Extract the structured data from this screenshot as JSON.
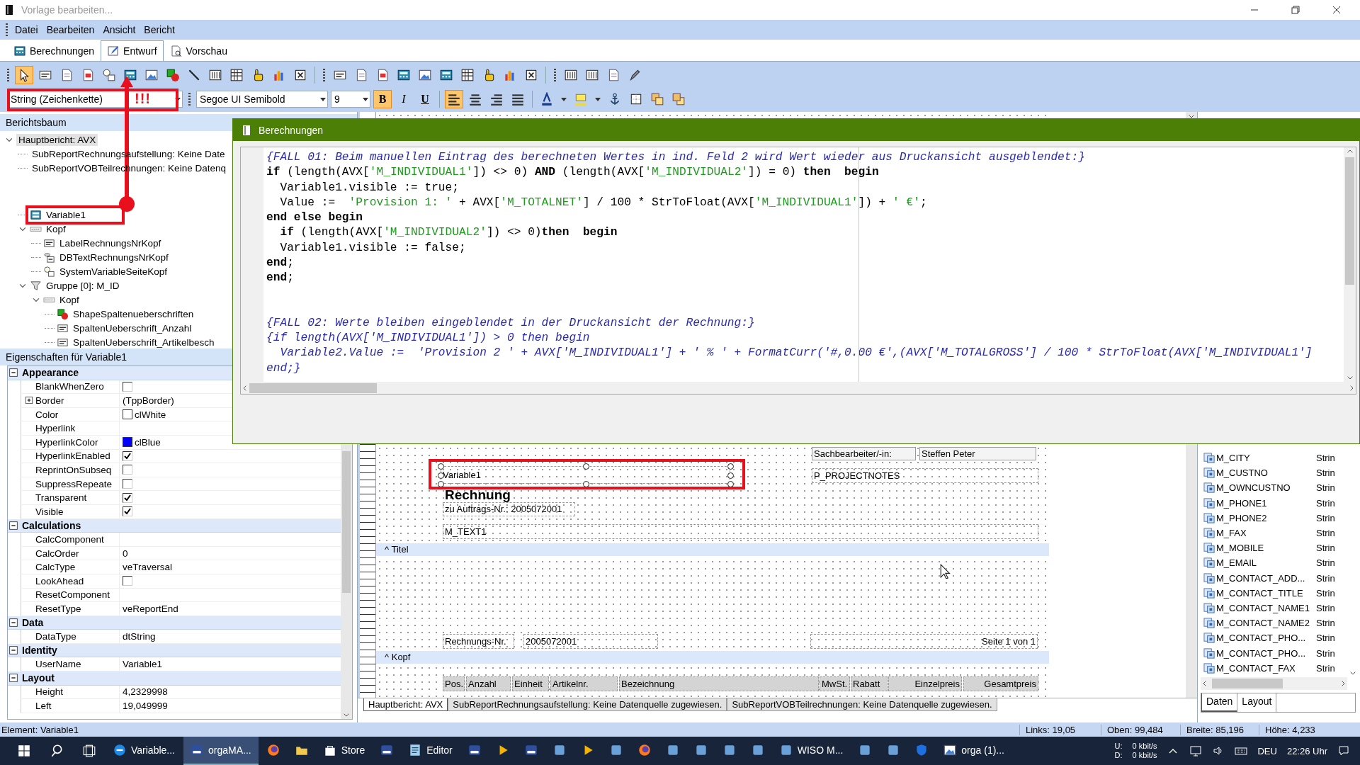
{
  "window": {
    "title": "Vorlage bearbeiten..."
  },
  "menu": [
    {
      "label": "Datei"
    },
    {
      "label": "Bearbeiten"
    },
    {
      "label": "Ansicht"
    },
    {
      "label": "Bericht"
    }
  ],
  "tabs": [
    {
      "label": "Berechnungen",
      "kind": "calc",
      "selected": false
    },
    {
      "label": "Entwurf",
      "kind": "edit",
      "selected": true
    },
    {
      "label": "Vorschau",
      "kind": "preview",
      "selected": false
    }
  ],
  "tools": [
    {
      "kind": "pointer",
      "selected": true
    },
    {
      "kind": "label",
      "selected": false
    },
    {
      "kind": "page",
      "selected": false
    },
    {
      "kind": "pagered",
      "selected": false
    },
    {
      "kind": "sysvar",
      "selected": false
    },
    {
      "kind": "calc",
      "selected": false
    },
    {
      "kind": "image",
      "selected": false
    },
    {
      "kind": "shape",
      "selected": false
    },
    {
      "kind": "line",
      "selected": false
    },
    {
      "kind": "table",
      "selected": false
    },
    {
      "kind": "grid",
      "selected": false
    },
    {
      "kind": "hand",
      "selected": false
    },
    {
      "kind": "chart",
      "selected": false
    },
    {
      "kind": "xbox",
      "selected": false
    },
    {
      "kind": "label",
      "selected": false
    },
    {
      "kind": "page",
      "selected": false
    },
    {
      "kind": "pagered",
      "selected": false
    },
    {
      "kind": "calc",
      "selected": false
    },
    {
      "kind": "image",
      "selected": false
    },
    {
      "kind": "calc",
      "selected": false
    },
    {
      "kind": "grid",
      "selected": false
    },
    {
      "kind": "hand",
      "selected": false
    },
    {
      "kind": "chart",
      "selected": false
    },
    {
      "kind": "xbox",
      "selected": false
    },
    {
      "kind": "table",
      "selected": false
    },
    {
      "kind": "table",
      "selected": false
    },
    {
      "kind": "page",
      "selected": false
    },
    {
      "kind": "pen",
      "selected": false
    }
  ],
  "format_bar": {
    "type_value": "String (Zeichenkette)",
    "font_value": "Segoe UI Semibold",
    "size_value": "9",
    "styles": [
      {
        "label": "B",
        "kind": "bold",
        "selected": true
      },
      {
        "label": "I",
        "kind": "italic",
        "selected": false
      },
      {
        "label": "U",
        "kind": "underline",
        "selected": false
      }
    ],
    "alignment": [
      {
        "kind": "left",
        "selected": true
      },
      {
        "kind": "center",
        "selected": false
      },
      {
        "kind": "right",
        "selected": false
      },
      {
        "kind": "justify",
        "selected": false
      }
    ]
  },
  "annotation": {
    "text": "!!!"
  },
  "report_tree": {
    "title": "Berichtsbaum",
    "nodes": [
      {
        "label": "Hauptbericht: AVX",
        "expanded": true,
        "selected": true,
        "children": [
          {
            "label": "SubReportRechnungsaufstellung: Keine Date",
            "selected": false
          },
          {
            "label": "SubReportVOBTeilrechnungen: Keine Datenq",
            "selected": false
          }
        ]
      }
    ],
    "nodes_lower": [
      {
        "label": "Variable1",
        "kind": "variable",
        "selected": false
      },
      {
        "label": "Kopf",
        "kind": "band",
        "expanded": true,
        "selected": false,
        "children": [
          {
            "label": "LabelRechnungsNrKopf",
            "kind": "label",
            "selected": false
          },
          {
            "label": "DBTextRechnungsNrKopf",
            "kind": "dbtext",
            "selected": false
          },
          {
            "label": "SystemVariableSeiteKopf",
            "kind": "sysvar",
            "selected": false
          }
        ]
      },
      {
        "label": "Gruppe [0]: M_ID",
        "kind": "group",
        "expanded": true,
        "selected": false,
        "children": [
          {
            "label": "Kopf",
            "kind": "band",
            "expanded": true,
            "selected": false,
            "children": [
              {
                "label": "ShapeSpaltenueberschriften",
                "kind": "shape",
                "selected": false
              },
              {
                "label": "SpaltenUeberschrift_Anzahl",
                "kind": "label",
                "selected": false
              },
              {
                "label": "SpaltenUeberschrift_Artikelbesch",
                "kind": "label",
                "selected": false
              }
            ]
          }
        ]
      }
    ]
  },
  "properties": {
    "title": "Eigenschaften für Variable1",
    "categories": [
      {
        "label": "Appearance",
        "expanded": true,
        "rows": [
          {
            "name": "BlankWhenZero",
            "kind": "check",
            "checked": false
          },
          {
            "name": "Border",
            "kind": "text",
            "value": "(TppBorder)",
            "expanded": false
          },
          {
            "name": "Color",
            "kind": "color",
            "value": "clWhite",
            "color": "#ffffff"
          },
          {
            "name": "Hyperlink",
            "kind": "text"
          },
          {
            "name": "HyperlinkColor",
            "kind": "color",
            "value": "clBlue",
            "color": "#0000ff"
          },
          {
            "name": "HyperlinkEnabled",
            "kind": "check",
            "checked": true
          },
          {
            "name": "ReprintOnSubseq",
            "kind": "check",
            "checked": false
          },
          {
            "name": "SuppressRepeate",
            "kind": "check",
            "checked": false
          },
          {
            "name": "Transparent",
            "kind": "check",
            "checked": true
          },
          {
            "name": "Visible",
            "kind": "check",
            "checked": true
          }
        ]
      },
      {
        "label": "Calculations",
        "expanded": true,
        "rows": [
          {
            "name": "CalcComponent",
            "kind": "text"
          },
          {
            "name": "CalcOrder",
            "kind": "text",
            "value": "0"
          },
          {
            "name": "CalcType",
            "kind": "text",
            "value": "veTraversal"
          },
          {
            "name": "LookAhead",
            "kind": "check",
            "checked": false
          },
          {
            "name": "ResetComponent",
            "kind": "text"
          },
          {
            "name": "ResetType",
            "kind": "text",
            "value": "veReportEnd"
          }
        ]
      },
      {
        "label": "Data",
        "expanded": true,
        "rows": [
          {
            "name": "DataType",
            "kind": "text",
            "value": "dtString"
          }
        ]
      },
      {
        "label": "Identity",
        "expanded": true,
        "rows": [
          {
            "name": "UserName",
            "kind": "text",
            "value": "Variable1"
          }
        ]
      },
      {
        "label": "Layout",
        "expanded": true,
        "rows": [
          {
            "name": "Height",
            "kind": "text",
            "value": "4,2329998"
          },
          {
            "name": "Left",
            "kind": "text",
            "value": "19,049999"
          }
        ]
      }
    ]
  },
  "code_window": {
    "title": "Berechnungen",
    "blocks": [
      [
        {
          "segments": [
            {
              "kind": "comment",
              "text": "{FALL 01: Beim manuellen Eintrag des berechneten Wertes in ind. Feld 2 wird Wert wieder aus Druckansicht ausgeblendet:}"
            }
          ]
        },
        {
          "segments": [
            {
              "kind": "keyword",
              "text": "if"
            },
            {
              "kind": "plain",
              "text": " (length(AVX["
            },
            {
              "kind": "string",
              "text": "'M_INDIVIDUAL1'"
            },
            {
              "kind": "plain",
              "text": "]) <> 0) "
            },
            {
              "kind": "keyword",
              "text": "AND"
            },
            {
              "kind": "plain",
              "text": " (length(AVX["
            },
            {
              "kind": "string",
              "text": "'M_INDIVIDUAL2'"
            },
            {
              "kind": "plain",
              "text": "]) = 0) "
            },
            {
              "kind": "keyword",
              "text": "then  begin"
            }
          ]
        },
        {
          "segments": [
            {
              "kind": "plain",
              "text": "  Variable1.visible := true;"
            }
          ]
        },
        {
          "segments": [
            {
              "kind": "plain",
              "text": "  Value :=  "
            },
            {
              "kind": "string",
              "text": "'Provision 1: '"
            },
            {
              "kind": "plain",
              "text": " + AVX["
            },
            {
              "kind": "string",
              "text": "'M_TOTALNET'"
            },
            {
              "kind": "plain",
              "text": "] / 100 * StrToFloat(AVX["
            },
            {
              "kind": "string",
              "text": "'M_INDIVIDUAL1'"
            },
            {
              "kind": "plain",
              "text": "]) + "
            },
            {
              "kind": "string",
              "text": "' €'"
            },
            {
              "kind": "plain",
              "text": ";"
            }
          ]
        },
        {
          "segments": [
            {
              "kind": "keyword",
              "text": "end else begin"
            }
          ]
        },
        {
          "segments": [
            {
              "kind": "keyword",
              "text": "  if"
            },
            {
              "kind": "plain",
              "text": " (length(AVX["
            },
            {
              "kind": "string",
              "text": "'M_INDIVIDUAL2'"
            },
            {
              "kind": "plain",
              "text": "]) <> 0)"
            },
            {
              "kind": "keyword",
              "text": "then  begin"
            }
          ]
        },
        {
          "segments": [
            {
              "kind": "plain",
              "text": "  Variable1.visible := false;"
            }
          ]
        },
        {
          "segments": [
            {
              "kind": "keyword",
              "text": "end"
            },
            {
              "kind": "plain",
              "text": ";"
            }
          ]
        },
        {
          "segments": [
            {
              "kind": "keyword",
              "text": "end"
            },
            {
              "kind": "plain",
              "text": ";"
            }
          ]
        }
      ],
      [
        {
          "segments": [
            {
              "kind": "comment",
              "text": "{FALL 02: Werte bleiben eingeblendet in der Druckansicht der Rechnung:}"
            }
          ]
        },
        {
          "segments": [
            {
              "kind": "comment",
              "text": "{if length(AVX['M_INDIVIDUAL1']) > 0 then begin"
            }
          ]
        },
        {
          "segments": [
            {
              "kind": "comment",
              "text": "  Variable2.Value :=  'Provision 2 ' + AVX['M_INDIVIDUAL1'] + ' % ' + FormatCurr('#,0.00 €',(AVX['M_TOTALGROSS'] / 100 * StrToFloat(AVX['M_INDIVIDUAL1']"
            }
          ]
        },
        {
          "segments": [
            {
              "kind": "comment",
              "text": "end;}"
            }
          ]
        }
      ]
    ]
  },
  "design": {
    "fields": [
      {
        "kind": "framed",
        "text": "Sachbearbeiter/-in:"
      },
      {
        "kind": "framed",
        "text": "Steffen Peter"
      },
      {
        "kind": "selected",
        "text": "Variable1"
      },
      {
        "kind": "field",
        "text": "P_PROJECTNOTES"
      },
      {
        "kind": "heading",
        "text": "Rechnung"
      },
      {
        "kind": "field",
        "text": "zu Auftrags-Nr.: 2005072001"
      },
      {
        "kind": "field",
        "text": "M_TEXT1"
      },
      {
        "kind": "field",
        "text": "Rechnungs-Nr."
      },
      {
        "kind": "field",
        "text": "2005072001"
      },
      {
        "kind": "field",
        "text": "Seite 1 von 1"
      }
    ],
    "bands": [
      {
        "label": "^ Titel"
      },
      {
        "label": "^ Kopf"
      }
    ],
    "column_headers": [
      "Pos.",
      "Anzahl",
      "Einheit",
      "Artikelnr.",
      "Bezeichnung",
      "MwSt.",
      "Rabatt",
      "Einzelpreis",
      "Gesamtpreis"
    ],
    "report_tabs": [
      {
        "label": "Hauptbericht: AVX",
        "selected": true
      },
      {
        "label": "SubReportRechnungsaufstellung: Keine Datenquelle zugewiesen.",
        "selected": false
      },
      {
        "label": "SubReportVOBTeilrechnungen: Keine Datenquelle zugewiesen.",
        "selected": false
      }
    ]
  },
  "data_panel": {
    "fields": [
      {
        "name": "M_CITY",
        "type": "Strin"
      },
      {
        "name": "M_CUSTNO",
        "type": "Strin"
      },
      {
        "name": "M_OWNCUSTNO",
        "type": "Strin"
      },
      {
        "name": "M_PHONE1",
        "type": "Strin"
      },
      {
        "name": "M_PHONE2",
        "type": "Strin"
      },
      {
        "name": "M_FAX",
        "type": "Strin"
      },
      {
        "name": "M_MOBILE",
        "type": "Strin"
      },
      {
        "name": "M_EMAIL",
        "type": "Strin"
      },
      {
        "name": "M_CONTACT_ADD...",
        "type": "Strin"
      },
      {
        "name": "M_CONTACT_TITLE",
        "type": "Strin"
      },
      {
        "name": "M_CONTACT_NAME1",
        "type": "Strin"
      },
      {
        "name": "M_CONTACT_NAME2",
        "type": "Strin"
      },
      {
        "name": "M_CONTACT_PHO...",
        "type": "Strin"
      },
      {
        "name": "M_CONTACT_PHO...",
        "type": "Strin"
      },
      {
        "name": "M_CONTACT_FAX",
        "type": "Strin"
      }
    ],
    "tabs": [
      {
        "label": "Daten",
        "selected": true
      },
      {
        "label": "Layout",
        "selected": false
      }
    ]
  },
  "status_bar": {
    "element": "Element: Variable1",
    "left": "Links: 19,05",
    "top": "Oben: 99,484",
    "width": "Breite: 85,196",
    "height": "Höhe: 4,233"
  },
  "taskbar": {
    "apps": [
      {
        "kind": "browser",
        "label": "Variable...",
        "selected": false
      },
      {
        "kind": "om",
        "label": "orgaMA...",
        "selected": true
      },
      {
        "kind": "globe",
        "selected": false
      },
      {
        "kind": "folder",
        "selected": false
      },
      {
        "kind": "store",
        "label": "Store",
        "selected": false
      },
      {
        "kind": "om",
        "selected": false
      },
      {
        "kind": "editor",
        "label": "Editor",
        "selected": false
      },
      {
        "kind": "om",
        "selected": false
      },
      {
        "kind": "media",
        "selected": false
      },
      {
        "kind": "om",
        "selected": false
      },
      {
        "kind": "app",
        "selected": false
      },
      {
        "kind": "media",
        "selected": false
      },
      {
        "kind": "app",
        "selected": false
      },
      {
        "kind": "globe",
        "selected": false
      },
      {
        "kind": "app",
        "selected": false
      },
      {
        "kind": "app",
        "selected": false
      },
      {
        "kind": "app",
        "selected": false
      },
      {
        "kind": "app",
        "selected": false
      },
      {
        "kind": "app",
        "label": "WISO M...",
        "selected": false
      },
      {
        "kind": "app",
        "selected": false
      },
      {
        "kind": "app",
        "selected": false
      },
      {
        "kind": "shield",
        "selected": false
      },
      {
        "kind": "image",
        "label": "orga (1)...",
        "selected": false
      }
    ],
    "net_up": "U:",
    "net_down": "D:",
    "rate_up": "0 kbit/s",
    "rate_down": "0 kbit/s",
    "language": "DEU",
    "clock": "22:26 Uhr"
  }
}
